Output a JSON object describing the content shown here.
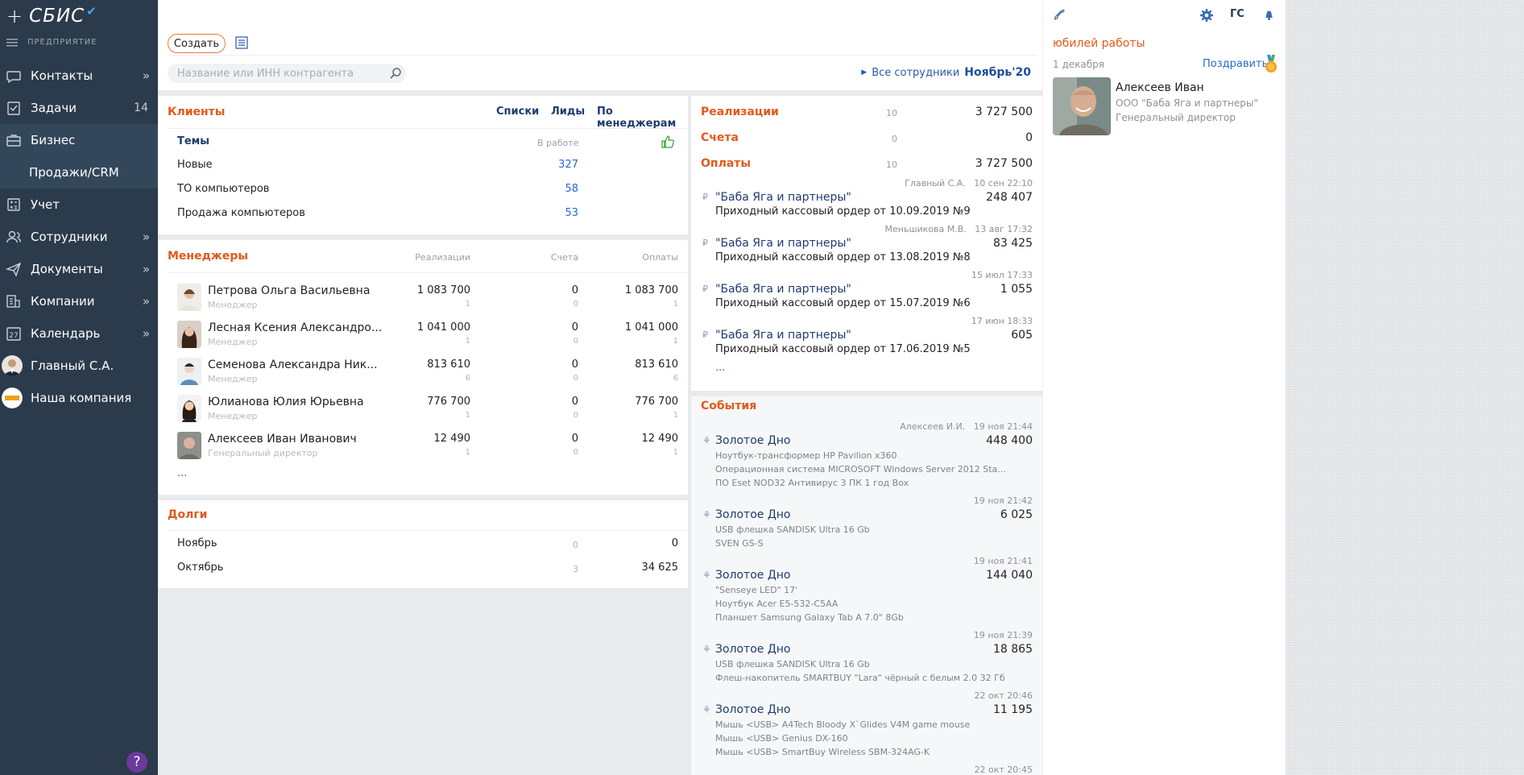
{
  "sidebar": {
    "logo": "СБИС",
    "org": "ПРЕДПРИЯТИЕ",
    "items": [
      {
        "label": "Контакты",
        "icon": "contacts-icon",
        "arrow": "»"
      },
      {
        "label": "Задачи",
        "icon": "tasks-icon",
        "count": "14"
      },
      {
        "label": "Бизнес",
        "icon": "briefcase-icon"
      },
      {
        "label": "Продажи/CRM"
      },
      {
        "label": "Учет",
        "icon": "calculator-icon"
      },
      {
        "label": "Сотрудники",
        "icon": "employees-icon",
        "arrow": "»"
      },
      {
        "label": "Документы",
        "icon": "documents-icon",
        "arrow": "»"
      },
      {
        "label": "Компании",
        "icon": "companies-icon",
        "arrow": "»"
      },
      {
        "label": "Календарь",
        "icon": "calendar-icon",
        "arrow": "»",
        "icon_text": "27"
      },
      {
        "label": "Главный С.А.",
        "icon": "user-avatar"
      },
      {
        "label": "Наша компания",
        "icon": "company-logo"
      }
    ],
    "help": "?"
  },
  "toolbar": {
    "create_label": "Создать",
    "search_placeholder": "Название или ИНН контрагента",
    "all_employees": "Все сотрудники",
    "period": "Ноябрь'20"
  },
  "clients": {
    "title": "Клиенты",
    "links": [
      "Списки",
      "Лиды",
      "По менеджерам"
    ],
    "col_themes": "Темы",
    "col_inwork": "В работе",
    "rows": [
      {
        "label": "Новые",
        "value": "327"
      },
      {
        "label": "ТО компьютеров",
        "value": "58"
      },
      {
        "label": "Продажа компьютеров",
        "value": "53"
      }
    ]
  },
  "managers": {
    "title": "Менеджеры",
    "cols": [
      "Реализации",
      "Счета",
      "Оплаты"
    ],
    "rows": [
      {
        "name": "Петрова Ольга Васильевна",
        "role": "Менеджер",
        "real": "1 083 700",
        "real_n": "1",
        "inv": "0",
        "inv_n": "0",
        "pay": "1 083 700",
        "pay_n": "1"
      },
      {
        "name": "Лесная Ксения Александро...",
        "role": "Менеджер",
        "real": "1 041 000",
        "real_n": "1",
        "inv": "0",
        "inv_n": "0",
        "pay": "1 041 000",
        "pay_n": "1"
      },
      {
        "name": "Семенова Александра Ник...",
        "role": "Менеджер",
        "real": "813 610",
        "real_n": "6",
        "inv": "0",
        "inv_n": "0",
        "pay": "813 610",
        "pay_n": "6"
      },
      {
        "name": "Юлианова Юлия Юрьевна",
        "role": "Менеджер",
        "real": "776 700",
        "real_n": "1",
        "inv": "0",
        "inv_n": "0",
        "pay": "776 700",
        "pay_n": "1"
      },
      {
        "name": "Алексеев Иван Иванович",
        "role": "Генеральный директор",
        "real": "12 490",
        "real_n": "1",
        "inv": "0",
        "inv_n": "0",
        "pay": "12 490",
        "pay_n": "1"
      }
    ],
    "more": "..."
  },
  "debts": {
    "title": "Долги",
    "rows": [
      {
        "label": "Ноябрь",
        "count": "0",
        "value": "0"
      },
      {
        "label": "Октябрь",
        "count": "3",
        "value": "34 625"
      }
    ]
  },
  "finance": {
    "rows": [
      {
        "label": "Реализации",
        "count": "10",
        "value": "3 727 500"
      },
      {
        "label": "Счета",
        "count": "0",
        "value": "0"
      },
      {
        "label": "Оплаты",
        "count": "10",
        "value": "3 727 500"
      }
    ],
    "docs": [
      {
        "author": "Главный С.А.",
        "date": "10 сен 22:10",
        "cp": "\"Баба Яга и партнеры\"",
        "desc": "Приходный кассовый ордер от 10.09.2019 №9",
        "sum": "248 407"
      },
      {
        "author": "Меньшикова М.В.",
        "date": "13 авг 17:32",
        "cp": "\"Баба Яга и партнеры\"",
        "desc": "Приходный кассовый ордер от 13.08.2019 №8",
        "sum": "83 425"
      },
      {
        "author": "",
        "date": "15 июл 17:33",
        "cp": "\"Баба Яга и партнеры\"",
        "desc": "Приходный кассовый ордер от 15.07.2019 №6",
        "sum": "1 055"
      },
      {
        "author": "",
        "date": "17 июн 18:33",
        "cp": "\"Баба Яга и партнеры\"",
        "desc": "Приходный кассовый ордер от 17.06.2019 №5",
        "sum": "605"
      }
    ],
    "more": "..."
  },
  "events": {
    "title": "События",
    "items": [
      {
        "author": "Алексеев И.И.",
        "date": "19 ноя 21:44",
        "title": "Золотое Дно",
        "sum": "448 400",
        "lines": [
          "Ноутбук-трансформер HP Pavilion x360",
          "Операционная система MICROSOFT Windows Server 2012 Sta...",
          "ПО Eset NOD32 Антивирус 3 ПК 1 год Box"
        ]
      },
      {
        "author": "",
        "date": "19 ноя 21:42",
        "title": "Золотое Дно",
        "sum": "6 025",
        "lines": [
          "USB флешка SANDISK Ultra 16 Gb",
          "SVEN GS-S"
        ]
      },
      {
        "author": "",
        "date": "19 ноя 21:41",
        "title": "Золотое Дно",
        "sum": "144 040",
        "lines": [
          "\"Senseye LED\" 17'",
          "Ноутбук Acer E5-532-C5AA",
          "Планшет Samsung Galaxy Tab A 7.0\" 8Gb"
        ]
      },
      {
        "author": "",
        "date": "19 ноя 21:39",
        "title": "Золотое Дно",
        "sum": "18 865",
        "lines": [
          "USB флешка SANDISK Ultra 16 Gb",
          "Флеш-накопитель SMARTBUY \"Lara\" чёрный с белым 2.0 32 Гб"
        ]
      },
      {
        "author": "",
        "date": "22 окт 20:46",
        "title": "Золотое Дно",
        "sum": "11 195",
        "lines": [
          "Мышь <USB> A4Tech Bloody X`Glides V4M game mouse",
          "Мышь <USB> Genius DX-160",
          "Мышь <USB> SmartBuy Wireless SBM-324AG-K"
        ]
      },
      {
        "author": "",
        "date": "22 окт 20:45",
        "title": "",
        "sum": "",
        "lines": []
      }
    ]
  },
  "right": {
    "initials": "ГС",
    "title": "юбилей работы",
    "date": "1 декабря",
    "congratulate": "Поздравить",
    "person": {
      "name": "Алексеев Иван",
      "company": "ООО \"Баба Яга и партнеры\"",
      "position": "Генеральный директор"
    }
  },
  "colors": {
    "accent": "#e05a1c",
    "sidebar": "#2b3b4b",
    "link": "#2a6acb"
  }
}
